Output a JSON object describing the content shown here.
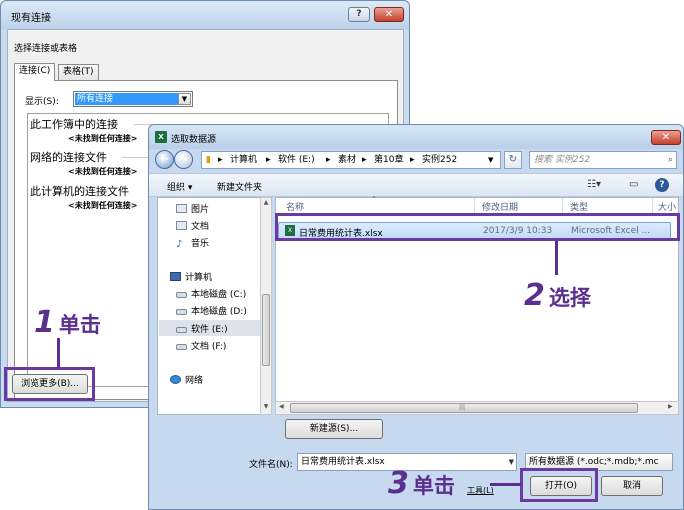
{
  "back_dialog": {
    "title": "现有连接",
    "help_button": "?",
    "close_button": "✕",
    "instruction": "选择连接或表格",
    "tabs": [
      {
        "label": "连接(C)"
      },
      {
        "label": "表格(T)"
      }
    ],
    "show_label": "显示(S):",
    "show_value": "所有连接",
    "sections": [
      {
        "title": "此工作簿中的连接",
        "empty": "<未找到任何连接>"
      },
      {
        "title": "网络的连接文件",
        "empty": "<未找到任何连接>"
      },
      {
        "title": "此计算机的连接文件",
        "empty": "<未找到任何连接>"
      }
    ],
    "browse_button": "浏览更多(B)..."
  },
  "annotations": {
    "step1": {
      "number": "1",
      "text": "单击"
    },
    "step2": {
      "number": "2",
      "text": "选择"
    },
    "step3": {
      "number": "3",
      "text": "单击"
    },
    "color": "#5a2f8f"
  },
  "front_dialog": {
    "title": "选取数据源",
    "app_icon": "X",
    "close_button": "✕",
    "breadcrumbs": [
      "计算机",
      "软件 (E:)",
      "素材",
      "第10章",
      "实例252"
    ],
    "search_placeholder": "搜索 实例252",
    "toolbar": {
      "organize": "组织 ▾",
      "new_folder": "新建文件夹"
    },
    "nav_items": [
      {
        "label": "图片",
        "icon": "pictures-icon"
      },
      {
        "label": "文档",
        "icon": "documents-icon"
      },
      {
        "label": "音乐",
        "icon": "music-icon"
      },
      {
        "label": "计算机",
        "icon": "computer-icon"
      },
      {
        "label": "本地磁盘 (C:)",
        "icon": "drive-icon"
      },
      {
        "label": "本地磁盘 (D:)",
        "icon": "drive-icon"
      },
      {
        "label": "软件 (E:)",
        "icon": "drive-icon"
      },
      {
        "label": "文档 (F:)",
        "icon": "drive-icon"
      },
      {
        "label": "网络",
        "icon": "network-icon"
      }
    ],
    "columns": [
      "名称",
      "修改日期",
      "类型",
      "大小"
    ],
    "files": [
      {
        "name": "日常费用统计表.xlsx",
        "modified": "2017/3/9 10:33",
        "type": "Microsoft Excel ..."
      }
    ],
    "new_source_button": "新建源(S)...",
    "filename_label": "文件名(N):",
    "filename_value": "日常费用统计表.xlsx",
    "filter_value": "所有数据源 (*.odc;*.mdb;*.mc",
    "tools_label": "工具(L)",
    "open_button": "打开(O)",
    "cancel_button": "取消"
  }
}
